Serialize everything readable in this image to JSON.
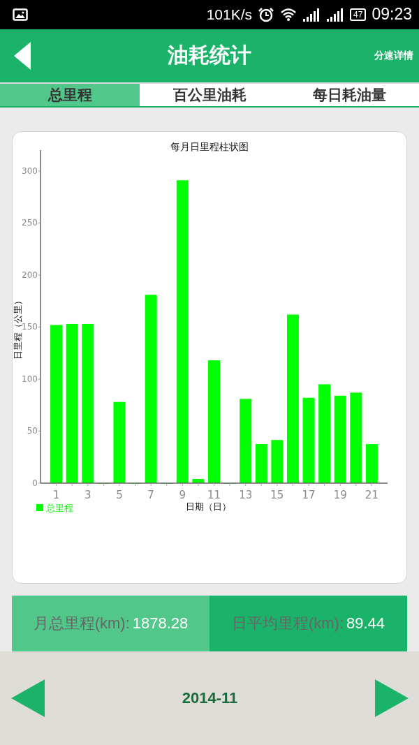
{
  "status_bar": {
    "speed": "101K/s",
    "battery": "47",
    "time": "09:23"
  },
  "header": {
    "title": "油耗统计",
    "action": "分速详情"
  },
  "tabs": [
    {
      "label": "总里程",
      "selected": true
    },
    {
      "label": "百公里油耗",
      "selected": false
    },
    {
      "label": "每日耗油量",
      "selected": false
    }
  ],
  "chart": {
    "chart_data": {
      "type": "bar",
      "title": "每月日里程柱状图",
      "xlabel": "日期（日）",
      "ylabel": "日里程（公里）",
      "x": [
        1,
        2,
        3,
        4,
        5,
        6,
        7,
        8,
        9,
        10,
        11,
        12,
        13,
        14,
        15,
        16,
        17,
        18,
        19,
        20,
        21
      ],
      "series": [
        {
          "name": "总里程",
          "color": "#00ff00",
          "values": [
            152,
            153,
            153,
            0,
            78,
            0,
            181,
            0,
            291,
            4,
            118,
            0,
            81,
            37.5,
            41.5,
            162,
            82,
            95,
            84,
            87,
            37.5
          ]
        }
      ],
      "xlim": [
        0,
        22
      ],
      "ylim": [
        0,
        320
      ],
      "yticks": [
        0,
        50,
        100,
        150,
        200,
        250,
        300
      ],
      "xticks": [
        1,
        3,
        5,
        7,
        9,
        11,
        13,
        15,
        17,
        19,
        21
      ]
    }
  },
  "summary": [
    {
      "label": "月总里程(km):",
      "value": "1878.28",
      "selected": true
    },
    {
      "label": "日平均里程(km):",
      "value": "89.44",
      "selected": false
    }
  ],
  "footer": {
    "month": "2014-11"
  }
}
